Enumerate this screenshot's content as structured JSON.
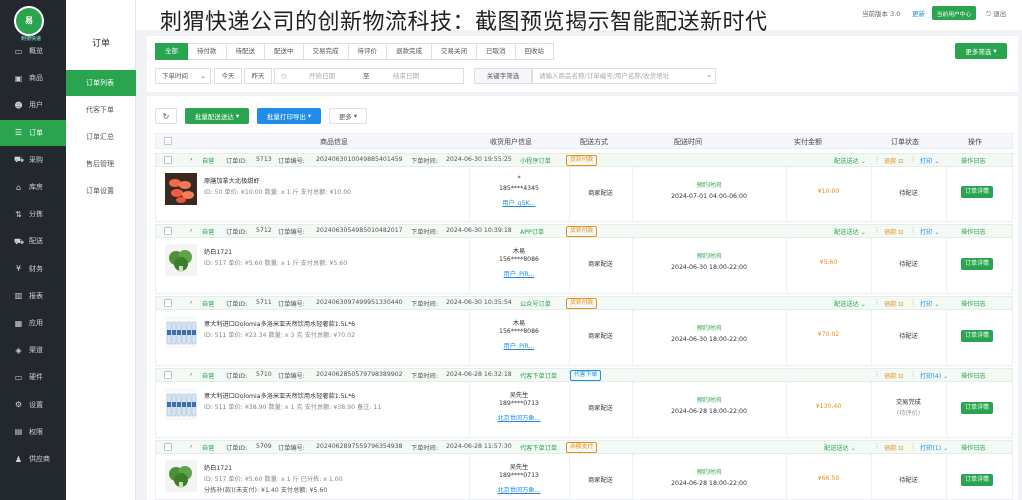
{
  "headline": "刺猬快递公司的创新物流科技：截图预览揭示智能配送新时代",
  "brand": {
    "logo_text": "易",
    "tagline": "刺猬快递"
  },
  "topbar": {
    "version_label": "当前版本",
    "version": "3.0",
    "update": "更新",
    "user_btn": "当前用户中心",
    "logout": "退出"
  },
  "nav": [
    {
      "label": "概览",
      "icon": "monitor-icon"
    },
    {
      "label": "商品",
      "icon": "box-icon"
    },
    {
      "label": "用户",
      "icon": "users-icon"
    },
    {
      "label": "订单",
      "icon": "order-icon"
    },
    {
      "label": "采购",
      "icon": "cart-icon"
    },
    {
      "label": "库房",
      "icon": "warehouse-icon"
    },
    {
      "label": "分拣",
      "icon": "sort-icon"
    },
    {
      "label": "配送",
      "icon": "truck-icon"
    },
    {
      "label": "财务",
      "icon": "yen-icon"
    },
    {
      "label": "报表",
      "icon": "chart-icon"
    },
    {
      "label": "应用",
      "icon": "apps-icon"
    },
    {
      "label": "渠道",
      "icon": "channel-icon"
    },
    {
      "label": "硬件",
      "icon": "device-icon"
    },
    {
      "label": "设置",
      "icon": "gear-icon"
    },
    {
      "label": "权限",
      "icon": "lock-icon"
    },
    {
      "label": "供应商",
      "icon": "supplier-icon"
    }
  ],
  "submenu": {
    "title": "订单",
    "items": [
      "订单列表",
      "代客下单",
      "订单汇总",
      "售后管理",
      "订单设置"
    ]
  },
  "tabs": [
    "全部",
    "待付款",
    "待配送",
    "配送中",
    "交易完成",
    "待评价",
    "退款完成",
    "交易关闭",
    "已取消",
    "回收站"
  ],
  "more_filter": "更多筛选",
  "filters": {
    "time_type": "下单时间",
    "today": "今天",
    "yesterday": "昨天",
    "start_ph": "开始日期",
    "to": "至",
    "end_ph": "结束日期",
    "keyword_type": "关键字筛选",
    "keyword_ph": "请输入商品名称/订单编号/用户名称/收货地址"
  },
  "toolbar": {
    "refresh": "↻",
    "batch_ship": "批量配送送达",
    "batch_print": "批量打印导出",
    "more": "更多"
  },
  "columns": [
    "商品信息",
    "收货用户信息",
    "配送方式",
    "配送时间",
    "实付金额",
    "订单状态",
    "操作"
  ],
  "orders": [
    {
      "shop": "自营",
      "id_label": "订单ID:",
      "id": "5713",
      "no_label": "订单编号:",
      "no": "2024063010049885401459",
      "time_label": "下单时间:",
      "time": "2024-06-30 19:55:25",
      "source": "小程序订单",
      "tag": "货到付款",
      "tag_color": "#e8901a",
      "product": "原膳加拿大北极甜虾",
      "meta": "ID: 50  单价: ¥10.00  数量: x 1 斤  支付总额: ¥10.00",
      "extra": "",
      "receiver": "*",
      "phone": "185****4345",
      "user": "用户_g5K...",
      "delivery": "商家配送",
      "slot": "预约时间",
      "slot_time": "2024-07-01 04:00-06:00",
      "amount": "¥10.00",
      "status": "待配送",
      "status2": "",
      "ship_label": "配送送达",
      "refund": "退款",
      "print": "打印",
      "log": "操作日志",
      "detail": "订单详情",
      "img": "shrimp"
    },
    {
      "shop": "自营",
      "id_label": "订单ID:",
      "id": "5712",
      "no_label": "订单编号:",
      "no": "2024063054985010482017",
      "time_label": "下单时间:",
      "time": "2024-06-30 10:39:18",
      "source": "APP订单",
      "tag": "货到付款",
      "tag_color": "#e8901a",
      "product": "奶白1721",
      "meta": "ID: 517  单价: ¥5.60  数量: x 1 斤  支付总额: ¥5.60",
      "extra": "",
      "receiver": "木易",
      "phone": "156****8086",
      "user": "用户_PiR...",
      "delivery": "商家配送",
      "slot": "预约时间",
      "slot_time": "2024-06-30 18:00-22:00",
      "amount": "¥5.60",
      "status": "待配送",
      "status2": "",
      "ship_label": "配送送达",
      "refund": "退款",
      "print": "打印",
      "log": "操作日志",
      "detail": "订单详情",
      "img": "veg"
    },
    {
      "shop": "自营",
      "id_label": "订单ID:",
      "id": "5711",
      "no_label": "订单编号:",
      "no": "2024063097499951330440",
      "time_label": "下单时间:",
      "time": "2024-06-30 10:35:54",
      "source": "公众号订单",
      "tag": "货到付款",
      "tag_color": "#e8901a",
      "product": "意大利进口Dolomia多洛米亚天然饮用水轻奢款1.5L*6",
      "meta": "ID: 511  单价: ¥23.34  数量: x 3 克  支付总额: ¥70.02",
      "extra": "",
      "receiver": "木易",
      "phone": "156****8086",
      "user": "用户_PiR...",
      "delivery": "商家配送",
      "slot": "预约时间",
      "slot_time": "2024-06-30 18:00-22:00",
      "amount": "¥70.02",
      "status": "待配送",
      "status2": "",
      "ship_label": "配送送达",
      "refund": "退款",
      "print": "打印",
      "log": "操作日志",
      "detail": "订单详情",
      "img": "water"
    },
    {
      "shop": "自营",
      "id_label": "订单ID:",
      "id": "5710",
      "no_label": "订单编号:",
      "no": "2024062850579798389902",
      "time_label": "下单时间:",
      "time": "2024-06-28 16:32:18",
      "source": "代客下单订单",
      "tag": "代客下单",
      "tag_color": "#1e8ce8",
      "product": "意大利进口Dolomia多洛米亚天然饮用水轻奢款1.5L*6",
      "meta": "ID: 511  单价: ¥38.90  数量: x 1 克  支付总额: ¥38.90  备注: 11",
      "extra": "",
      "receiver": "吴先生",
      "phone": "189****0713",
      "user": "北京世间万象...",
      "delivery": "商家配送",
      "slot": "预约时间",
      "slot_time": "2024-06-28 18:00-22:00",
      "amount": "¥130.40",
      "status": "交易完成",
      "status2": "(待评价)",
      "ship_label": "",
      "refund": "退款",
      "print": "打印(4)",
      "log": "操作日志",
      "detail": "订单详情",
      "img": "water"
    },
    {
      "shop": "自营",
      "id_label": "订单ID:",
      "id": "5709",
      "no_label": "订单编号:",
      "no": "2024062897559796354938",
      "time_label": "下单时间:",
      "time": "2024-06-28 11:57:30",
      "source": "代客下单订单",
      "tag": "余额支付",
      "tag_color": "#e8901a",
      "product": "奶白1721",
      "meta": "ID: 517  单价: ¥5.60  数量: x 1 斤  已分拣: x 1.00",
      "extra": "分拣补(款)(未支付): ¥1.40  支付总额: ¥5.60",
      "receiver": "吴先生",
      "phone": "189****0713",
      "user": "北京世间万象...",
      "delivery": "商家配送",
      "slot": "预约时间",
      "slot_time": "2024-06-28 18:00-22:00",
      "amount": "¥66.50",
      "status": "待配送",
      "status2": "",
      "ship_label": "配送送达",
      "refund": "退款",
      "print": "打印(1)",
      "log": "操作日志",
      "detail": "订单详情",
      "img": "veg"
    }
  ],
  "colors": {
    "accent": "#2aa44f",
    "blue": "#1e8ce8",
    "orange": "#e8901a",
    "sidebar": "#23272e"
  }
}
